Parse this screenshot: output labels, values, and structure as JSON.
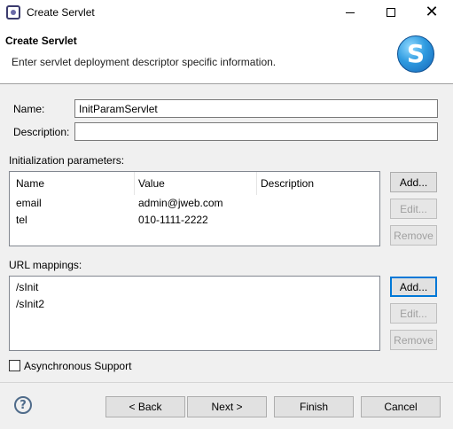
{
  "window": {
    "title": "Create Servlet",
    "icon": "eclipse-app-icon",
    "controls": {
      "minimize": "minimize-icon",
      "maximize": "maximize-icon",
      "close": "close-icon"
    }
  },
  "banner": {
    "title": "Create Servlet",
    "description": "Enter servlet deployment descriptor specific information.",
    "logo_icon": "servlet-logo-icon",
    "logo_text": "S"
  },
  "form": {
    "name_label": "Name:",
    "name_value": "InitParamServlet",
    "description_label": "Description:",
    "description_value": ""
  },
  "init_params": {
    "label": "Initialization parameters:",
    "columns": [
      "Name",
      "Value",
      "Description"
    ],
    "rows": [
      {
        "name": "email",
        "value": "admin@jweb.com",
        "description": ""
      },
      {
        "name": "tel",
        "value": "010-1111-2222",
        "description": ""
      }
    ],
    "buttons": {
      "add": "Add...",
      "edit": "Edit...",
      "remove": "Remove"
    }
  },
  "url_mappings": {
    "label": "URL mappings:",
    "items": [
      "/sInit",
      "/sInit2"
    ],
    "buttons": {
      "add": "Add...",
      "edit": "Edit...",
      "remove": "Remove"
    }
  },
  "async": {
    "label": "Asynchronous Support",
    "checked": false
  },
  "footer": {
    "help_icon": "help-icon",
    "help_glyph": "?",
    "back": "< Back",
    "next": "Next >",
    "finish": "Finish",
    "cancel": "Cancel"
  },
  "colors": {
    "focus_border": "#0078d7",
    "disabled_text": "#a0a0a0",
    "logo_blue": "#2f9be0"
  }
}
